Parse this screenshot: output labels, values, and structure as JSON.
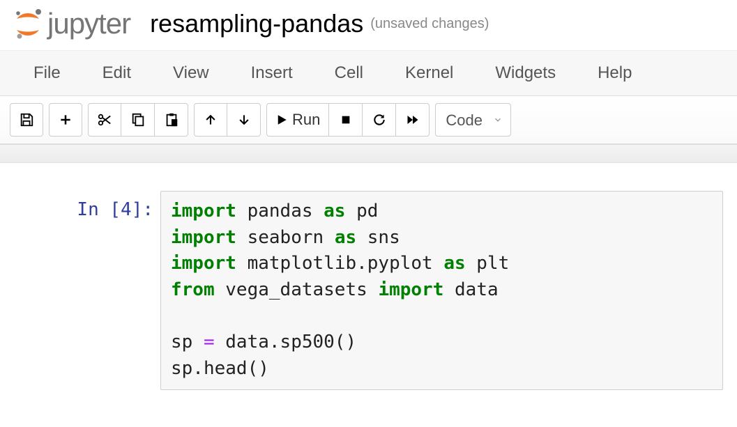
{
  "header": {
    "logo_text": "jupyter",
    "notebook_title": "resampling-pandas",
    "status": "(unsaved changes)"
  },
  "menu": {
    "file": "File",
    "edit": "Edit",
    "view": "View",
    "insert": "Insert",
    "cell": "Cell",
    "kernel": "Kernel",
    "widgets": "Widgets",
    "help": "Help"
  },
  "toolbar": {
    "run_label": "Run",
    "cell_type": "Code"
  },
  "cell": {
    "prompt": "In [4]:",
    "code_tokens": [
      {
        "t": "import",
        "c": "kw"
      },
      {
        "t": " pandas ",
        "c": ""
      },
      {
        "t": "as",
        "c": "kw"
      },
      {
        "t": " pd\n",
        "c": ""
      },
      {
        "t": "import",
        "c": "kw"
      },
      {
        "t": " seaborn ",
        "c": ""
      },
      {
        "t": "as",
        "c": "kw"
      },
      {
        "t": " sns\n",
        "c": ""
      },
      {
        "t": "import",
        "c": "kw"
      },
      {
        "t": " matplotlib.pyplot ",
        "c": ""
      },
      {
        "t": "as",
        "c": "kw"
      },
      {
        "t": " plt\n",
        "c": ""
      },
      {
        "t": "from",
        "c": "kw"
      },
      {
        "t": " vega_datasets ",
        "c": ""
      },
      {
        "t": "import",
        "c": "kw"
      },
      {
        "t": " data\n",
        "c": ""
      },
      {
        "t": "\n",
        "c": ""
      },
      {
        "t": "sp ",
        "c": ""
      },
      {
        "t": "=",
        "c": "op"
      },
      {
        "t": " data.sp500()\n",
        "c": ""
      },
      {
        "t": "sp.head()",
        "c": ""
      }
    ]
  }
}
